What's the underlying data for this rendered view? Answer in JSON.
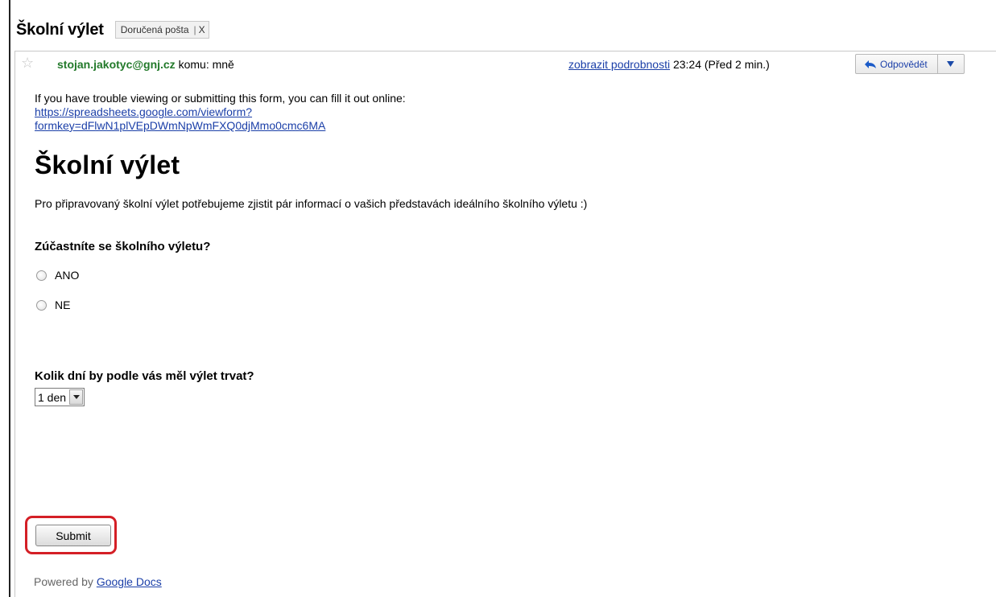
{
  "subject": {
    "title": "Školní výlet",
    "label": "Doručená pošta",
    "label_remove": "X"
  },
  "message": {
    "sender_email": "stojan.jakotyc@gnj.cz",
    "recipient": "komu: mně",
    "show_details": "zobrazit podrobnosti",
    "time": "23:24 (Před 2 min.)",
    "reply_label": "Odpovědět"
  },
  "form": {
    "notice": "If you have trouble viewing or submitting this form, you can fill it out online:",
    "link_line1": "https://spreadsheets.google.com/viewform?",
    "link_line2": "formkey=dFlwN1plVEpDWmNpWmFXQ0djMmo0cmc6MA",
    "title": "Školní výlet",
    "description": "Pro připravovaný školní výlet potřebujeme zjistit pár informací o vašich představách ideálního školního výletu :)",
    "question1": "Zúčastníte se školního výletu?",
    "option_yes": "ANO",
    "option_no": "NE",
    "question2": "Kolik dní by podle vás měl výlet trvat?",
    "select_value": "1 den",
    "submit_label": "Submit",
    "powered_by": "Powered by",
    "powered_link": "Google Docs"
  },
  "colors": {
    "sender": "#22792a",
    "link": "#1b3fa8",
    "highlight": "#d41f26"
  }
}
